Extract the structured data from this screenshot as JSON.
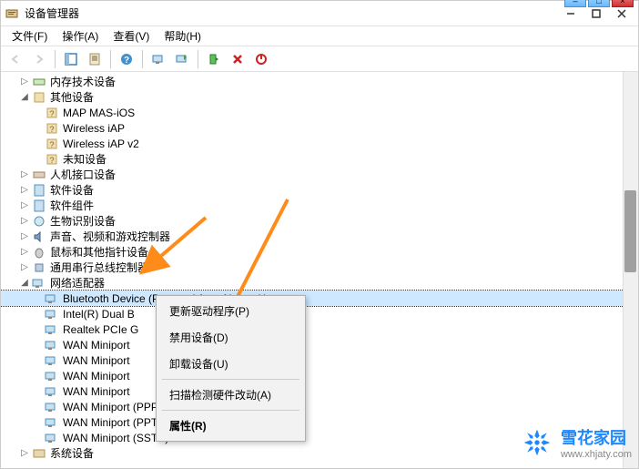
{
  "title": "设备管理器",
  "menus": {
    "file": "文件(F)",
    "action": "操作(A)",
    "view": "查看(V)",
    "help": "帮助(H)"
  },
  "tree": {
    "memory": "内存技术设备",
    "other": "其他设备",
    "other_items": [
      "MAP MAS-iOS",
      "Wireless iAP",
      "Wireless iAP v2",
      "未知设备"
    ],
    "hid": "人机接口设备",
    "software_dev": "软件设备",
    "software_comp": "软件组件",
    "biometric": "生物识别设备",
    "audio_video": "声音、视频和游戏控制器",
    "mouse": "鼠标和其他指针设备",
    "usb": "通用串行总线控制器",
    "network": "网络适配器",
    "network_items": [
      "Bluetooth Device (Personal Area Network)",
      "Intel(R) Dual B",
      "Realtek PCIe G",
      "WAN Miniport",
      "WAN Miniport",
      "WAN Miniport",
      "WAN Miniport",
      "WAN Miniport (PPPOE)",
      "WAN Miniport (PPTP)",
      "WAN Miniport (SSTP)"
    ],
    "system": "系统设备"
  },
  "context_menu": {
    "update_driver": "更新驱动程序(P)",
    "disable": "禁用设备(D)",
    "uninstall": "卸载设备(U)",
    "scan": "扫描检测硬件改动(A)",
    "properties": "属性(R)"
  },
  "watermark": {
    "text": "雪花家园",
    "url": "www.xhjaty.com"
  }
}
